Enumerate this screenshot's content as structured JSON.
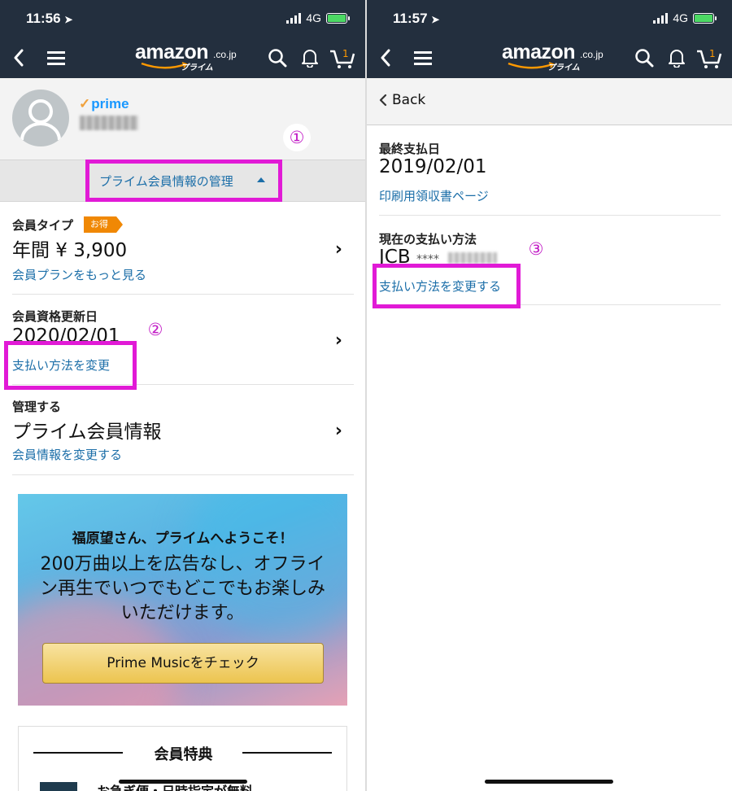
{
  "colors": {
    "topbar": "#232f3e",
    "link": "#1b6ea8",
    "highlight": "#e11ad6",
    "annotation": "#c21cc6",
    "tag": "#f08804",
    "prime": "#1a98ff"
  },
  "left": {
    "status": {
      "time": "11:56",
      "network": "4G"
    },
    "logo": {
      "word": "amazon",
      "tld": ".co.jp",
      "sub": "プライム"
    },
    "profile": {
      "prime_label": "prime"
    },
    "annotation1": "①",
    "annotation2": "②",
    "manage_link": "プライム会員情報の管理",
    "membership": {
      "label": "会員タイプ",
      "tag": "お得",
      "value": "年間 ¥ 3,900",
      "link": "会員プランをもっと見る"
    },
    "renewal": {
      "label": "会員資格更新日",
      "value": "2020/02/01",
      "link": "支払い方法を変更"
    },
    "manage": {
      "label": "管理する",
      "value": "プライム会員情報",
      "link": "会員情報を変更する"
    },
    "banner": {
      "title": "福原望さん、プライムへようこそ！",
      "body": "200万曲以上を広告なし、オフライン再生でいつでもどこでもお楽しみいただけます。",
      "button": "Prime Musicをチェック"
    },
    "benefits": {
      "title": "会員特典",
      "first": "お急ぎ便・日時指定が無料"
    }
  },
  "right": {
    "status": {
      "time": "11:57",
      "network": "4G"
    },
    "logo": {
      "word": "amazon",
      "tld": ".co.jp",
      "sub": "プライム"
    },
    "back": "Back",
    "annotation3": "③",
    "last_payment": {
      "label": "最終支払日",
      "value": "2019/02/01",
      "link": "印刷用領収書ページ"
    },
    "payment_method": {
      "label": "現在の支払い方法",
      "card": "JCB",
      "masked": "****",
      "link": "支払い方法を変更する"
    }
  }
}
